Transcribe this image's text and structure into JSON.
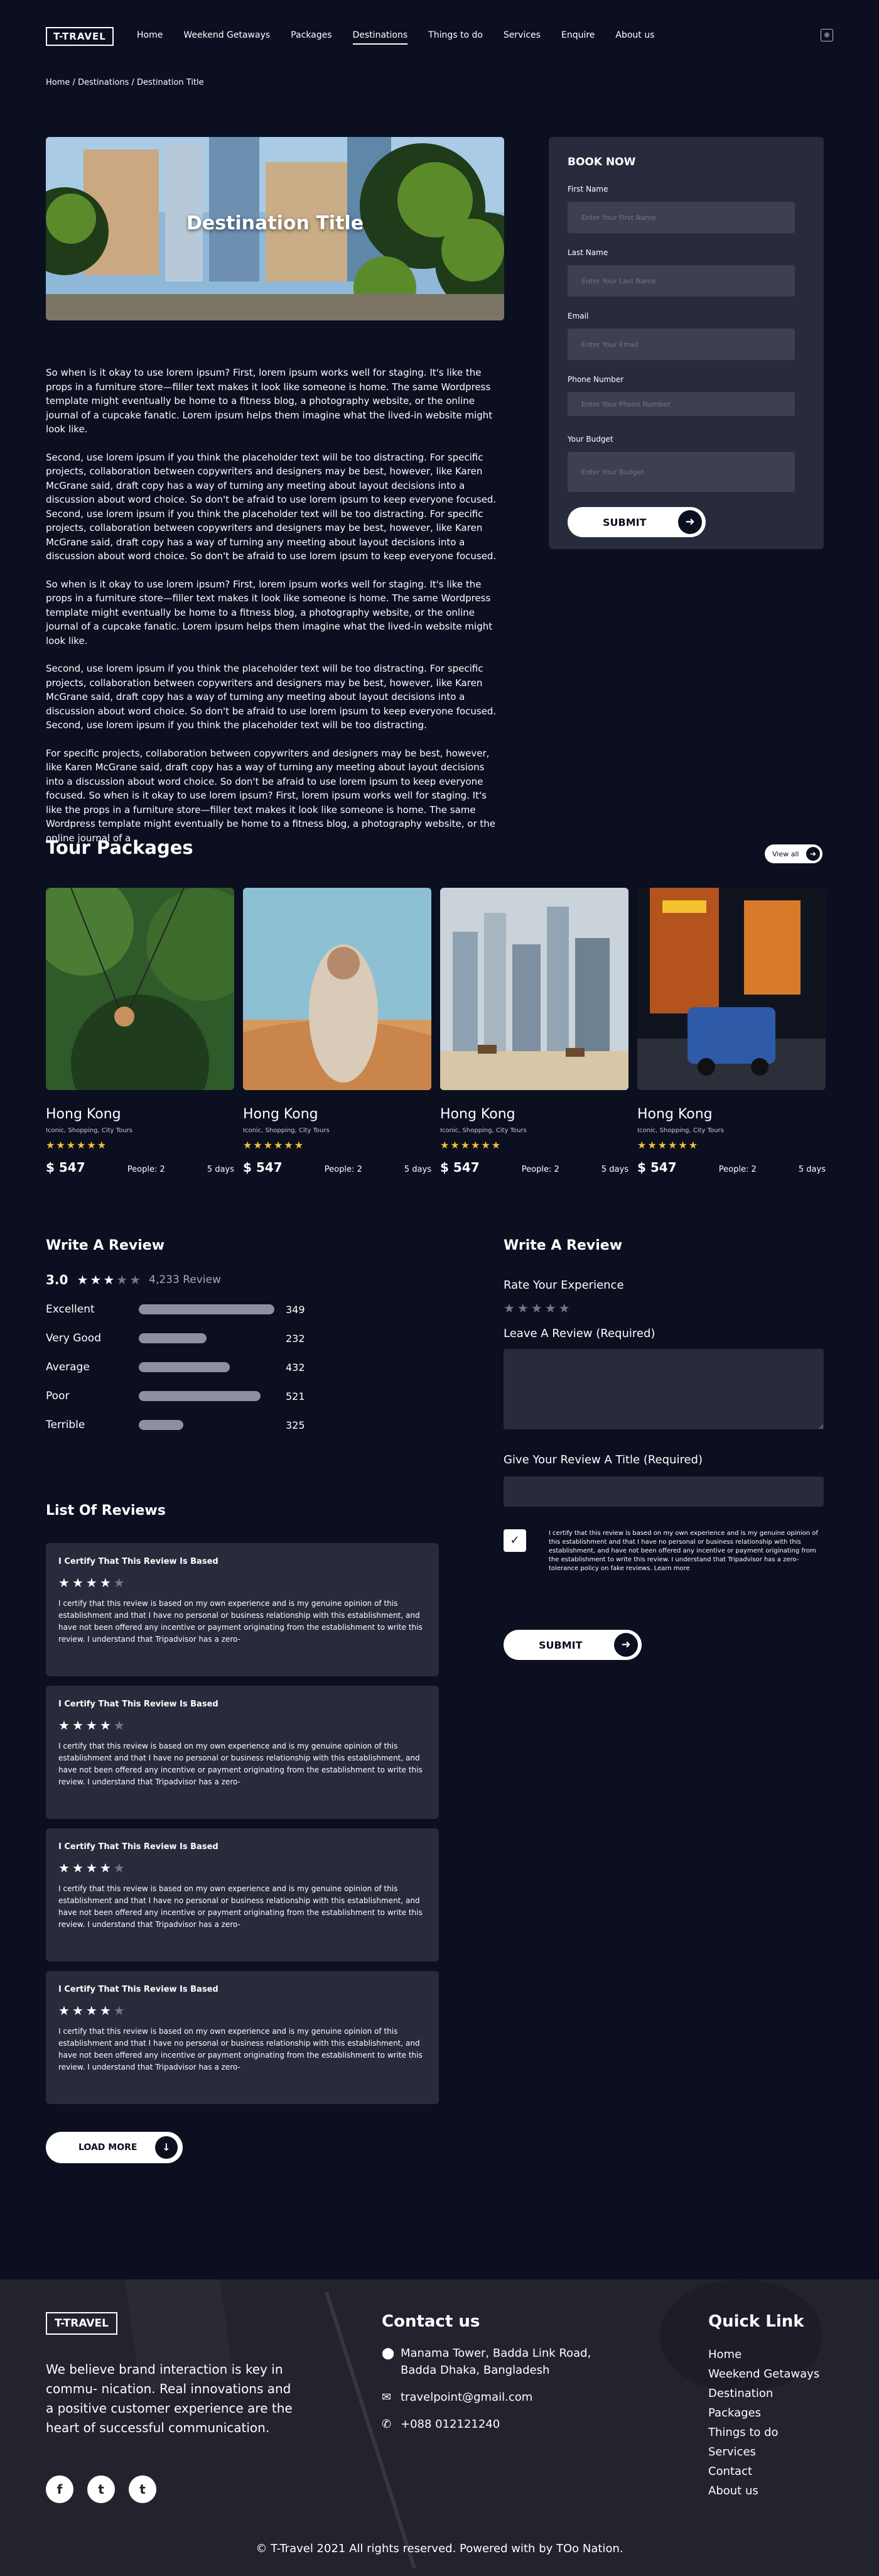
{
  "nav": {
    "logo": "T-TRAVEL",
    "links": [
      "Home",
      "Weekend Getaways",
      "Packages",
      "Destinations",
      "Things to do",
      "Services",
      "Enquire",
      "About us"
    ],
    "active": "Destinations"
  },
  "breadcrumb": "Home  /  Destinations / Destination Title",
  "hero": {
    "title": "Destination Title"
  },
  "article": [
    "So when is it okay to use lorem ipsum? First, lorem ipsum works well for staging. It's like the props in a furniture store—filler text makes it look like someone is home. The same Wordpress template might eventually be home to a fitness blog, a photography website, or the online journal of a cupcake fanatic. Lorem ipsum helps them imagine what the lived-in website might look like.",
    "Second, use lorem ipsum if you think the placeholder text will be too distracting. For specific projects, collaboration between copywriters and designers may be best, however, like Karen McGrane said, draft copy has a way of turning any meeting about layout decisions into a discussion about word choice. So don't be afraid to use lorem ipsum to keep everyone focused. Second, use lorem ipsum if you think the placeholder text will be too distracting. For specific projects, collaboration between copywriters and designers may be best, however, like Karen McGrane said, draft copy has a way of turning any meeting about layout decisions into a discussion about word choice. So don't be afraid to use lorem ipsum to keep everyone focused.",
    "So when is it okay to use lorem ipsum? First, lorem ipsum works well for staging. It's like the props in a furniture store—filler text makes it look like someone is home. The same Wordpress template might eventually be home to a fitness blog, a photography website, or the online journal of a cupcake fanatic. Lorem ipsum helps them imagine what the lived-in website might look like.",
    "Second, use lorem ipsum if you think the placeholder text will be too distracting. For specific projects, collaboration between copywriters and designers may be best, however, like Karen McGrane said, draft copy has a way of turning any meeting about layout decisions into a discussion about word choice. So don't be afraid to use lorem ipsum to keep everyone focused. Second, use lorem ipsum if you think the placeholder text will be too distracting.",
    " For specific projects, collaboration between copywriters and designers may be best, however, like Karen McGrane said, draft copy has a way of turning any meeting about layout decisions into a discussion about word choice. So don't be afraid to use lorem ipsum to keep everyone focused. So when is it okay to use lorem ipsum? First, lorem ipsum works well for staging. It's like the props in a furniture store—filler text makes it look like someone is home. The same Wordpress template might eventually be home to a fitness blog, a photography website, or the online journal of a"
  ],
  "booking": {
    "title": "BOOK NOW",
    "first_name_label": "First Name",
    "first_name_placeholder": "Enter Your First Name",
    "last_name_label": "Last Name",
    "last_name_placeholder": "Enter Your Last Name",
    "email_label": "Email",
    "email_placeholder": "Enter Your Email",
    "phone_label": "Phone Number",
    "phone_placeholder": "Enter Your Phone Number",
    "budget_label": "Your Budget",
    "budget_placeholder": "Enter Your Budget",
    "submit": "SUBMIT"
  },
  "tours": {
    "title": "Tour Packages",
    "view_all": "View all",
    "cards": [
      {
        "name": "Hong Kong",
        "tags": "Iconic, Shopping, City Tours",
        "stars": "★★★★★★",
        "price": "$ 547",
        "people": "People: 2",
        "days": "5 days",
        "image": "jungle-swing"
      },
      {
        "name": "Hong Kong",
        "tags": "Iconic, Shopping, City Tours",
        "stars": "★★★★★★",
        "price": "$ 547",
        "people": "People: 2",
        "days": "5 days",
        "image": "desert-woman"
      },
      {
        "name": "Hong Kong",
        "tags": "Iconic, Shopping, City Tours",
        "stars": "★★★★★★",
        "price": "$ 547",
        "people": "People: 2",
        "days": "5 days",
        "image": "skyline-camels"
      },
      {
        "name": "Hong Kong",
        "tags": "Iconic, Shopping, City Tours",
        "stars": "★★★★★★",
        "price": "$ 547",
        "people": "People: 2",
        "days": "5 days",
        "image": "night-street-tuktuk"
      }
    ]
  },
  "review_summary": {
    "title": "Write A Review",
    "score": "3.0",
    "count": "4,233 Review",
    "stars_filled": 3,
    "rows": [
      {
        "label": "Excellent",
        "value": "349",
        "fill": 1.0
      },
      {
        "label": "Very Good",
        "value": "232",
        "fill": 0.5
      },
      {
        "label": "Average",
        "value": "432",
        "fill": 0.67
      },
      {
        "label": "Poor",
        "value": "521",
        "fill": 0.9
      },
      {
        "label": "Terrible",
        "value": "325",
        "fill": 0.33
      }
    ]
  },
  "review_form": {
    "title": "Write A Review",
    "rate_label": "Rate Your Experience",
    "review_label": "Leave A Review (Required)",
    "title_label": "Give Your Review A Title (Required)",
    "certify": "I certify that this review is based on my own experience and is my genuine opinion of this establishment and that I have no personal or business relationship with this establishment, and have not been offered any incentive or payment originating from the establishment to write this review. I understand that Tripadvisor has a zero-tolerance policy on fake reviews. Learn more",
    "submit": "SUBMIT"
  },
  "reviews": {
    "title": "List Of Reviews",
    "items": [
      {
        "heading": "I Certify That This Review Is Based",
        "body": "I certify that this review is based on my own experience and is my genuine opinion of this establishment and that I have no personal or business relationship with this establishment, and have not been offered any incentive or payment originating from the establishment to write this review. I understand that Tripadvisor has a zero-"
      },
      {
        "heading": "I Certify That This Review Is Based",
        "body": "I certify that this review is based on my own experience and is my genuine opinion of this establishment and that I have no personal or business relationship with this establishment, and have not been offered any incentive or payment originating from the establishment to write this review. I understand that Tripadvisor has a zero-"
      },
      {
        "heading": "I Certify That This Review Is Based",
        "body": "I certify that this review is based on my own experience and is my genuine opinion of this establishment and that I have no personal or business relationship with this establishment, and have not been offered any incentive or payment originating from the establishment to write this review. I understand that Tripadvisor has a zero-"
      },
      {
        "heading": "I Certify That This Review Is Based",
        "body": "I certify that this review is based on my own experience and is my genuine opinion of this establishment and that I have no personal or business relationship with this establishment, and have not been offered any incentive or payment originating from the establishment to write this review. I understand that Tripadvisor has a zero-"
      }
    ],
    "load_more": "LOAD MORE"
  },
  "footer": {
    "logo": "T-TRAVEL",
    "about": "We believe brand interaction is key in commu- nication. Real innovations and a positive customer experience are the heart of successful communication.",
    "contact_title": "Contact us",
    "address": "Manama Tower, Badda Link Road, Badda Dhaka, Bangladesh",
    "email": "travelpoint@gmail.com",
    "phone": "+088 012121240",
    "links_title": "Quick Link",
    "links": [
      "Home",
      "Weekend Getaways",
      "Destination",
      "Packages",
      "Things to do",
      "Services",
      "Contact",
      "About us"
    ],
    "copyright": "© T-Travel 2021 All rights reserved. Powered with  by TOo Nation."
  },
  "colors": {
    "page_bg": "#0b0f20",
    "panel_bg": "#282b3c",
    "field_bg": "#3d4052",
    "bar_fill": "#8e90a0",
    "star_gold": "#f2c230"
  }
}
